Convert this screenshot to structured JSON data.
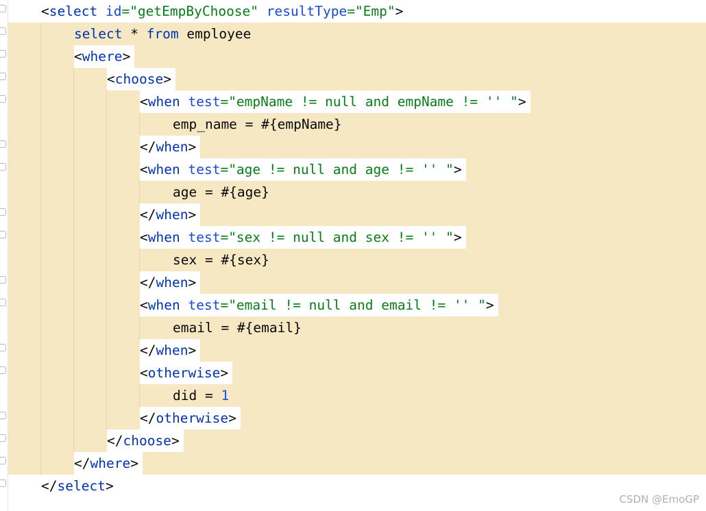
{
  "code": {
    "line1": {
      "open": "<",
      "tag": "select",
      "sp1": " ",
      "attr1": "id",
      "eq1": "=",
      "val1": "\"getEmpByChoose\"",
      "sp2": " ",
      "attr2": "resultType",
      "eq2": "=",
      "val2": "\"Emp\"",
      "close": ">"
    },
    "line2": {
      "kw1": "select",
      "rest1": " * ",
      "kw2": "from",
      "rest2": " employee"
    },
    "line3": {
      "open": "<",
      "tag": "where",
      "close": ">"
    },
    "line4": {
      "open": "<",
      "tag": "choose",
      "close": ">"
    },
    "line5": {
      "open": "<",
      "tag": "when",
      "sp": " ",
      "attr": "test",
      "eq": "=",
      "val": "\"empName != null and empName != '' \"",
      "close": ">"
    },
    "line6": {
      "text": "emp_name = #{empName}"
    },
    "line7": {
      "open": "</",
      "tag": "when",
      "close": ">"
    },
    "line8": {
      "open": "<",
      "tag": "when",
      "sp": " ",
      "attr": "test",
      "eq": "=",
      "val": "\"age != null and age != '' \"",
      "close": ">"
    },
    "line9": {
      "text": "age = #{age}"
    },
    "line10": {
      "open": "</",
      "tag": "when",
      "close": ">"
    },
    "line11": {
      "open": "<",
      "tag": "when",
      "sp": " ",
      "attr": "test",
      "eq": "=",
      "val": "\"sex != null and sex != '' \"",
      "close": ">"
    },
    "line12": {
      "text": "sex = #{sex}"
    },
    "line13": {
      "open": "</",
      "tag": "when",
      "close": ">"
    },
    "line14": {
      "open": "<",
      "tag": "when",
      "sp": " ",
      "attr": "test",
      "eq": "=",
      "val": "\"email != null and email != '' \"",
      "close": ">"
    },
    "line15": {
      "text": "email = #{email}"
    },
    "line16": {
      "open": "</",
      "tag": "when",
      "close": ">"
    },
    "line17": {
      "open": "<",
      "tag": "otherwise",
      "close": ">"
    },
    "line18": {
      "text": "did = ",
      "num": "1"
    },
    "line19": {
      "open": "</",
      "tag": "otherwise",
      "close": ">"
    },
    "line20": {
      "open": "</",
      "tag": "choose",
      "close": ">"
    },
    "line21": {
      "open": "</",
      "tag": "where",
      "close": ">"
    },
    "line22": {
      "open": "</",
      "tag": "select",
      "close": ">"
    }
  },
  "watermark": "CSDN @EmoGP",
  "colors": {
    "tag": "#0033b3",
    "attribute": "#174ad4",
    "attribute_value": "#067d17",
    "number": "#1750eb",
    "plain_text": "#080808",
    "block_highlight": "#f5e8c2"
  }
}
